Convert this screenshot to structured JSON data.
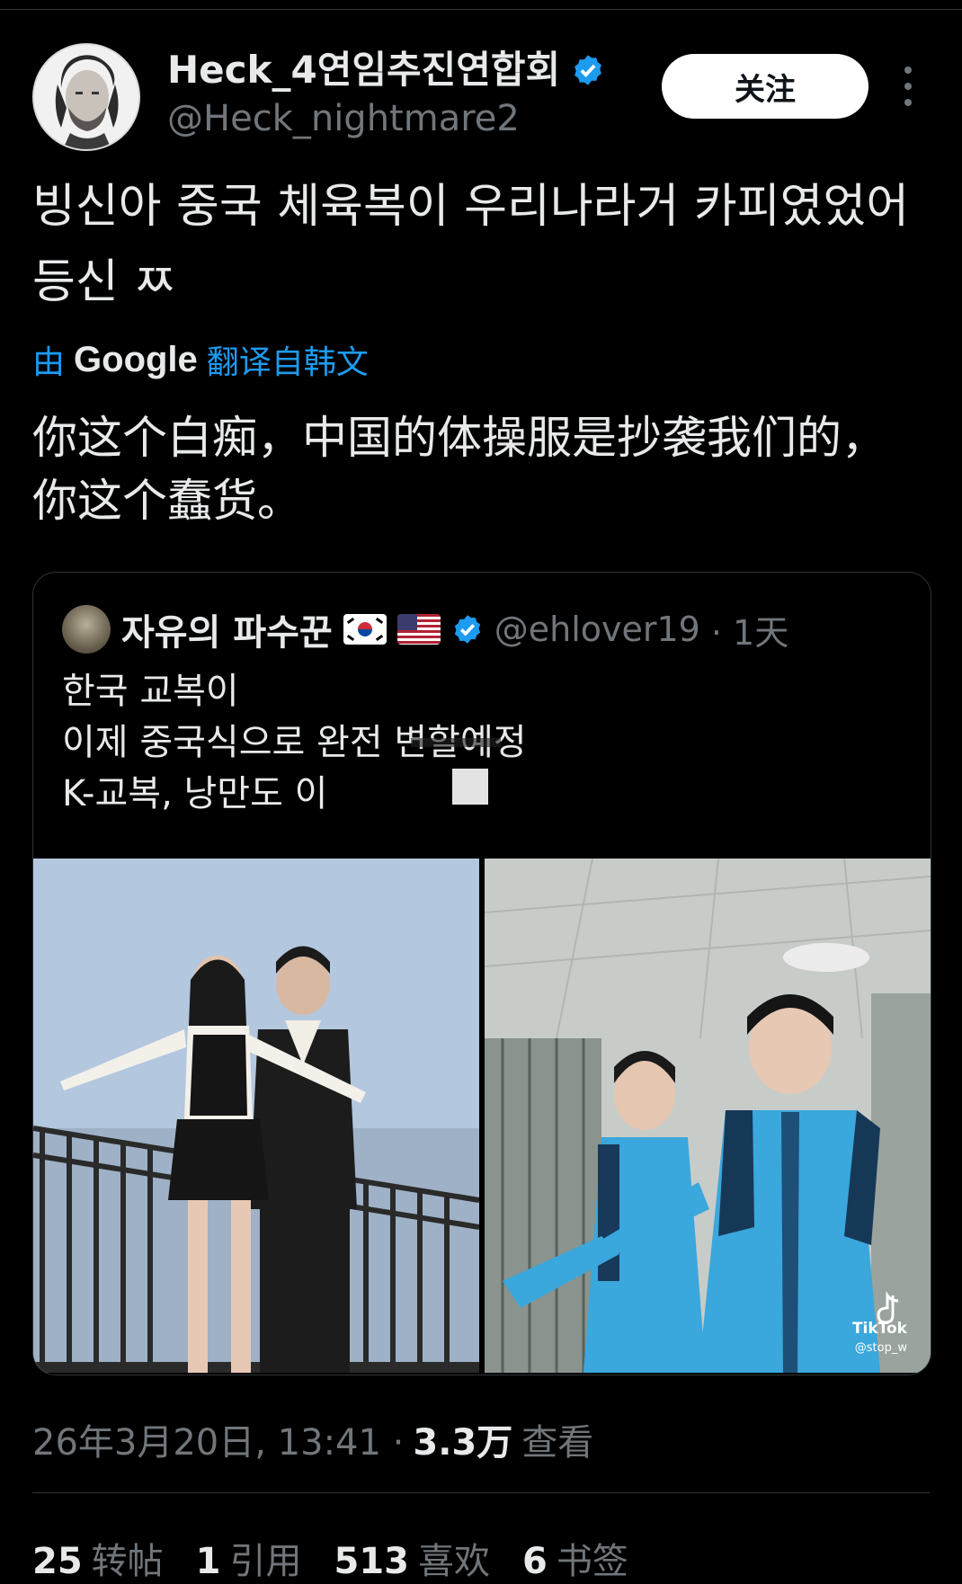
{
  "tweet": {
    "author": {
      "display_name": "Heck_4연임추진연합회",
      "handle": "@Heck_nightmare2",
      "verified": true
    },
    "follow_label": "关注",
    "text_lines": [
      "빙신아  중국 체육복이 우리나라거 카피였었어",
      "등신 ㅉ"
    ],
    "translation": {
      "prefix": "由",
      "brand": "Google",
      "label": "翻译自韩文",
      "lines": [
        "你这个白痴，中国的体操服是抄袭我们的，",
        "你这个蠢货。"
      ]
    },
    "quoted": {
      "display_name": "자유의 파수꾼",
      "handle": "@ehlover19",
      "time": "· 1天",
      "lines": [
        "한국 교복이",
        "이제 중국식으로 완전 변할예정",
        "K-교복, 낭만도 이"
      ],
      "media_watermark": "TikTok",
      "media_watermark_sub": "@stop_w"
    },
    "meta": {
      "timestamp": "26年3月20日, 13:41 ·",
      "views": "3.3万",
      "views_label": "查看"
    },
    "stats": [
      {
        "num": "25",
        "label": "转帖"
      },
      {
        "num": "1",
        "label": "引用"
      },
      {
        "num": "513",
        "label": "喜欢"
      },
      {
        "num": "6",
        "label": "书签"
      }
    ]
  },
  "colors": {
    "background": "#000000",
    "text": "#e7e9ea",
    "muted": "#71767b",
    "accent": "#1d9bf0"
  }
}
